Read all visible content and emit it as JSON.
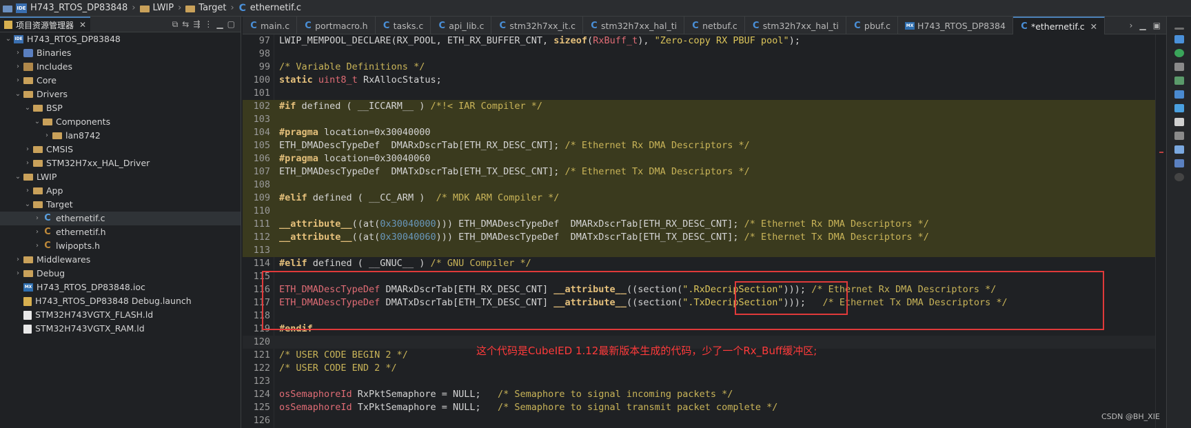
{
  "breadcrumb": [
    "H743_RTOS_DP83848",
    "LWIP",
    "Target",
    "ethernetif.c"
  ],
  "project_panel": {
    "title": "项目资源管理器",
    "tree": [
      {
        "label": "H743_RTOS_DP83848",
        "indent": 0,
        "icon": "ide",
        "arrow": "down"
      },
      {
        "label": "Binaries",
        "indent": 1,
        "icon": "bin",
        "arrow": "right"
      },
      {
        "label": "Includes",
        "indent": 1,
        "icon": "inc",
        "arrow": "right"
      },
      {
        "label": "Core",
        "indent": 1,
        "icon": "folder",
        "arrow": "right"
      },
      {
        "label": "Drivers",
        "indent": 1,
        "icon": "folder",
        "arrow": "down"
      },
      {
        "label": "BSP",
        "indent": 2,
        "icon": "folder",
        "arrow": "down"
      },
      {
        "label": "Components",
        "indent": 3,
        "icon": "folder",
        "arrow": "down"
      },
      {
        "label": "lan8742",
        "indent": 4,
        "icon": "folder",
        "arrow": "right"
      },
      {
        "label": "CMSIS",
        "indent": 2,
        "icon": "folder",
        "arrow": "right"
      },
      {
        "label": "STM32H7xx_HAL_Driver",
        "indent": 2,
        "icon": "folder",
        "arrow": "right"
      },
      {
        "label": "LWIP",
        "indent": 1,
        "icon": "folder",
        "arrow": "down"
      },
      {
        "label": "App",
        "indent": 2,
        "icon": "folder",
        "arrow": "right"
      },
      {
        "label": "Target",
        "indent": 2,
        "icon": "folder",
        "arrow": "down"
      },
      {
        "label": "ethernetif.c",
        "indent": 3,
        "icon": "c",
        "arrow": "right",
        "selected": true
      },
      {
        "label": "ethernetif.h",
        "indent": 3,
        "icon": "h",
        "arrow": "right"
      },
      {
        "label": "lwipopts.h",
        "indent": 3,
        "icon": "h",
        "arrow": "right"
      },
      {
        "label": "Middlewares",
        "indent": 1,
        "icon": "folder",
        "arrow": "right"
      },
      {
        "label": "Debug",
        "indent": 1,
        "icon": "folder",
        "arrow": "right"
      },
      {
        "label": "H743_RTOS_DP83848.ioc",
        "indent": 1,
        "icon": "mx",
        "arrow": ""
      },
      {
        "label": "H743_RTOS_DP83848 Debug.launch",
        "indent": 1,
        "icon": "launch",
        "arrow": ""
      },
      {
        "label": "STM32H743VGTX_FLASH.ld",
        "indent": 1,
        "icon": "ld",
        "arrow": ""
      },
      {
        "label": "STM32H743VGTX_RAM.ld",
        "indent": 1,
        "icon": "ld",
        "arrow": ""
      }
    ]
  },
  "editor_tabs": [
    {
      "label": "main.c",
      "icon": "c"
    },
    {
      "label": "portmacro.h",
      "icon": "c"
    },
    {
      "label": "tasks.c",
      "icon": "c"
    },
    {
      "label": "api_lib.c",
      "icon": "c"
    },
    {
      "label": "stm32h7xx_it.c",
      "icon": "c"
    },
    {
      "label": "stm32h7xx_hal_ti",
      "icon": "c"
    },
    {
      "label": "netbuf.c",
      "icon": "c"
    },
    {
      "label": "stm32h7xx_hal_ti",
      "icon": "c"
    },
    {
      "label": "pbuf.c",
      "icon": "c"
    },
    {
      "label": "H743_RTOS_DP8384",
      "icon": "mx"
    },
    {
      "label": "*ethernetif.c",
      "icon": "c",
      "active": true,
      "closable": true
    }
  ],
  "code_lines": [
    {
      "n": "97",
      "html": "LWIP_MEMPOOL_DECLARE(RX_POOL, ETH_RX_BUFFER_CNT, <span class=\"k\">sizeof</span>(<span class=\"ty\">RxBuff_t</span>), <span class=\"st\">\"Zero-copy RX PBUF pool\"</span>);"
    },
    {
      "n": "98",
      "html": ""
    },
    {
      "n": "99",
      "html": "<span class=\"cm\">/* Variable Definitions */</span>"
    },
    {
      "n": "100",
      "html": "<span class=\"k\">static</span> <span class=\"ty\">uint8_t</span> RxAllocStatus;"
    },
    {
      "n": "101",
      "html": ""
    },
    {
      "n": "102",
      "hl": true,
      "html": "<span class=\"k\">#if</span> defined ( __ICCARM__ ) <span class=\"cm\">/*!&lt; IAR Compiler */</span>"
    },
    {
      "n": "103",
      "hl": true,
      "html": ""
    },
    {
      "n": "104",
      "hl": true,
      "html": "<span class=\"k\">#pragma</span> location=0x30040000"
    },
    {
      "n": "105",
      "hl": true,
      "html": "ETH_DMADescTypeDef  DMARxDscrTab[ETH_RX_DESC_CNT]; <span class=\"cm\">/* Ethernet Rx DMA Descriptors */</span>"
    },
    {
      "n": "106",
      "hl": true,
      "html": "<span class=\"k\">#pragma</span> location=0x30040060"
    },
    {
      "n": "107",
      "hl": true,
      "html": "ETH_DMADescTypeDef  DMATxDscrTab[ETH_TX_DESC_CNT]; <span class=\"cm\">/* Ethernet Tx DMA Descriptors */</span>"
    },
    {
      "n": "108",
      "hl": true,
      "html": ""
    },
    {
      "n": "109",
      "hl": true,
      "html": "<span class=\"k\">#elif</span> defined ( __CC_ARM )  <span class=\"cm\">/* MDK ARM Compiler */</span>"
    },
    {
      "n": "110",
      "hl": true,
      "html": ""
    },
    {
      "n": "111",
      "hl": true,
      "html": "<span class=\"k\">__attribute__</span>((at(<span class=\"nm\">0x30040000</span>))) ETH_DMADescTypeDef  DMARxDscrTab[ETH_RX_DESC_CNT]; <span class=\"cm\">/* Ethernet Rx DMA Descriptors */</span>"
    },
    {
      "n": "112",
      "hl": true,
      "html": "<span class=\"k\">__attribute__</span>((at(<span class=\"nm\">0x30040060</span>))) ETH_DMADescTypeDef  DMATxDscrTab[ETH_TX_DESC_CNT]; <span class=\"cm\">/* Ethernet Tx DMA Descriptors */</span>"
    },
    {
      "n": "113",
      "hl": true,
      "html": ""
    },
    {
      "n": "114",
      "html": "<span class=\"k\">#elif</span> defined ( __GNUC__ ) <span class=\"cm\">/* GNU Compiler */</span>"
    },
    {
      "n": "115",
      "html": ""
    },
    {
      "n": "116",
      "html": "<span class=\"ty\">ETH_DMADescTypeDef</span> DMARxDscrTab[ETH_RX_DESC_CNT] <span class=\"k\">__attribute__</span>((section(<span class=\"st\">\".RxDecripSection\"</span>))); <span class=\"cm\">/* Ethernet Rx DMA Descriptors */</span>"
    },
    {
      "n": "117",
      "html": "<span class=\"ty\">ETH_DMADescTypeDef</span> DMATxDscrTab[ETH_TX_DESC_CNT] <span class=\"k\">__attribute__</span>((section(<span class=\"st\">\".TxDecripSection\"</span>)));   <span class=\"cm\">/* Ethernet Tx DMA Descriptors */</span>"
    },
    {
      "n": "118",
      "html": ""
    },
    {
      "n": "119",
      "html": "<span class=\"k\">#endif</span>"
    },
    {
      "n": "120",
      "cur": true,
      "html": ""
    },
    {
      "n": "121",
      "html": "<span class=\"cm\">/* USER CODE BEGIN 2 */</span>"
    },
    {
      "n": "122",
      "html": "<span class=\"cm\">/* USER CODE END 2 */</span>"
    },
    {
      "n": "123",
      "html": ""
    },
    {
      "n": "124",
      "html": "<span class=\"ty\">osSemaphoreId</span> RxPktSemaphore = NULL;   <span class=\"cm\">/* Semaphore to signal incoming packets */</span>"
    },
    {
      "n": "125",
      "html": "<span class=\"ty\">osSemaphoreId</span> TxPktSemaphore = NULL;   <span class=\"cm\">/* Semaphore to signal transmit packet complete */</span>"
    },
    {
      "n": "126",
      "html": ""
    }
  ],
  "annotation": "这个代码是CubeIED 1.12最新版本生成的代码，少了一个Rx_Buff缓冲区;",
  "watermark": "CSDN @BH_XIE",
  "colors": {
    "annotation_red": "#e03a3a",
    "highlight_bg": "#3a3a1e",
    "accent": "#4a7fb5"
  }
}
